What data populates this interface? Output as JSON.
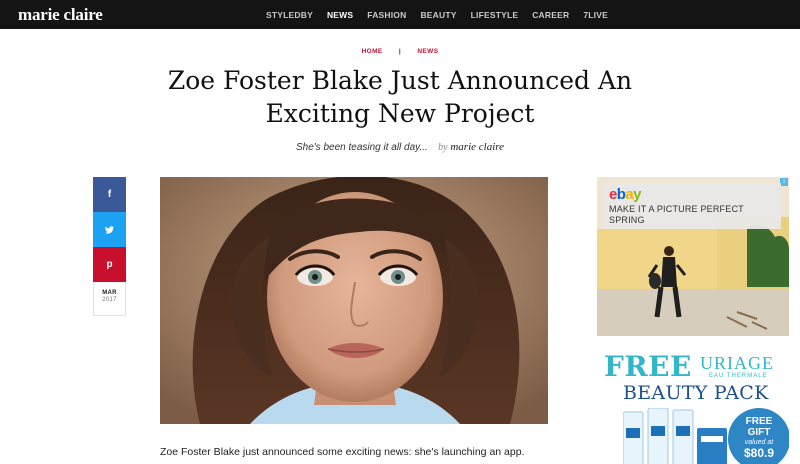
{
  "header": {
    "logo": "marie claire",
    "nav": [
      {
        "label": "STYLEDBY",
        "active": false
      },
      {
        "label": "NEWS",
        "active": true
      },
      {
        "label": "FASHION",
        "active": false
      },
      {
        "label": "BEAUTY",
        "active": false
      },
      {
        "label": "LIFESTYLE",
        "active": false
      },
      {
        "label": "CAREER",
        "active": false
      },
      {
        "label": "7LIVE",
        "active": false
      }
    ]
  },
  "breadcrumb": {
    "home": "HOME",
    "separator": "|",
    "section": "NEWS"
  },
  "article": {
    "title": "Zoe Foster Blake Just Announced An Exciting New Project",
    "teaser": "She's been teasing it all day...",
    "by": "by",
    "author": "marie claire",
    "date_month": "MAR",
    "date_year": "2017",
    "body_first_line": "Zoe Foster Blake just announced some exciting news: she's launching an app."
  },
  "share": {
    "facebook_icon": "f",
    "twitter_icon": "▾",
    "pinterest_icon": "p"
  },
  "ads": {
    "ebay": {
      "logo": {
        "e": "e",
        "b": "b",
        "a": "a",
        "y": "y"
      },
      "text": "MAKE IT A PICTURE PERFECT SPRING",
      "choices_icon": "i"
    },
    "uriage": {
      "free": "FREE",
      "brand": "URIAGE",
      "brand_sub": "EAU THERMALE",
      "headline": "BEAUTY PACK",
      "gift_line1": "FREE",
      "gift_line2": "GIFT",
      "gift_line3": "valued at",
      "gift_value": "$80.9"
    }
  },
  "colors": {
    "topbar": "#141414",
    "accent_red": "#c4122f",
    "facebook": "#3b5998",
    "twitter": "#1da1f2",
    "pinterest": "#c8102e",
    "uriage_teal": "#34b6c9",
    "uriage_navy": "#1d4f8a"
  }
}
